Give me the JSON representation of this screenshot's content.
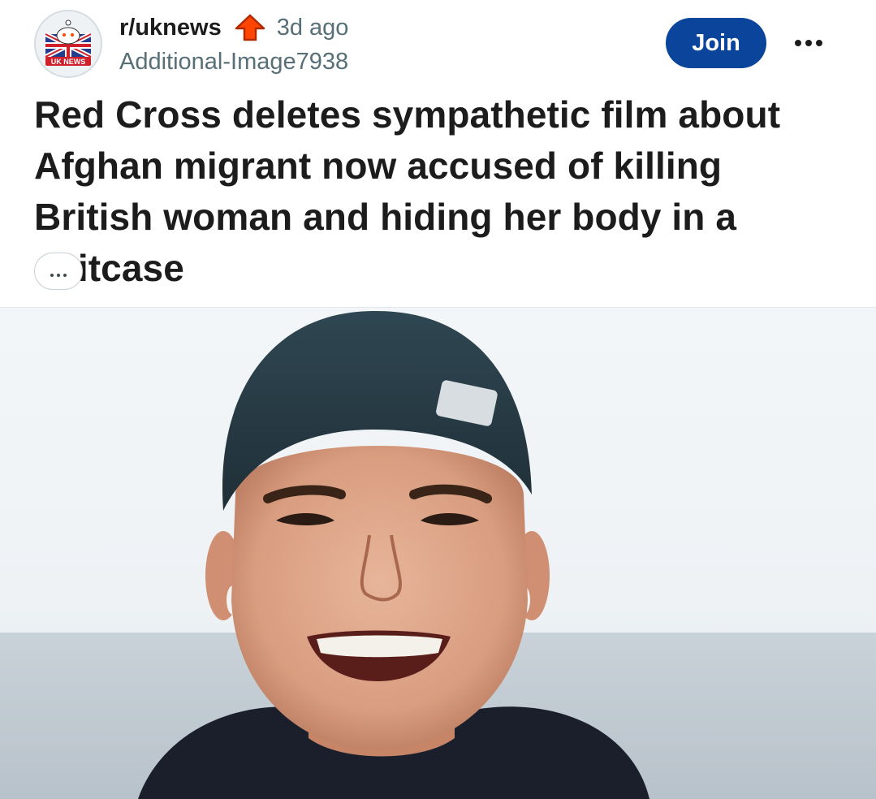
{
  "post": {
    "subreddit": "r/uknews",
    "subreddit_icon": "uk-news-community-avatar",
    "avatar_badge": "UK NEWS",
    "trending_icon": "trending-up-arrow-icon",
    "age": "3d ago",
    "author": "Additional-Image7938",
    "join_label": "Join",
    "more_icon": "ellipsis-icon",
    "title": "Red Cross deletes sympathetic film about Afghan migrant now accused of killing British woman and hiding her body in a suitcase",
    "expand_icon": "ellipsis-expand-icon",
    "media_description_icon": "photo-image"
  },
  "colors": {
    "join_button": "#0a449b",
    "trending_arrow": "#ff4500",
    "meta_text": "#576f76",
    "title_text": "#1c1c1c"
  }
}
